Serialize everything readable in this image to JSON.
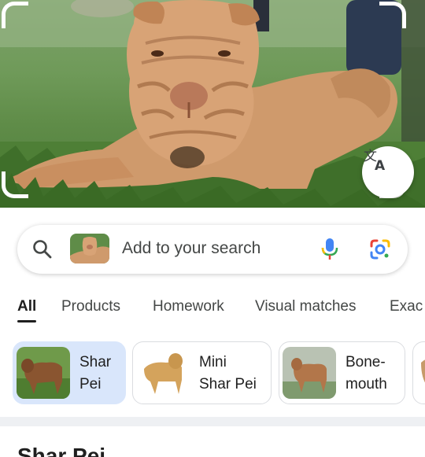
{
  "search": {
    "placeholder": "Add to your search"
  },
  "tabs": [
    {
      "label": "All",
      "active": true
    },
    {
      "label": "Products",
      "active": false
    },
    {
      "label": "Homework",
      "active": false
    },
    {
      "label": "Visual matches",
      "active": false
    },
    {
      "label": "Exac",
      "active": false
    }
  ],
  "chips": [
    {
      "line1": "Shar",
      "line2": "Pei",
      "selected": true
    },
    {
      "line1": "Mini",
      "line2": "Shar Pei",
      "selected": false
    },
    {
      "line1": "Bone-",
      "line2": "mouth",
      "selected": false
    }
  ],
  "result": {
    "title": "Shar Pei"
  },
  "icons": {
    "translate": "translate-icon",
    "search": "search-icon",
    "mic": "mic-icon",
    "lens": "google-lens-icon"
  },
  "colors": {
    "selected_chip": "#d9e6fb",
    "mic_blue": "#4285f4",
    "mic_red": "#ea4335"
  }
}
